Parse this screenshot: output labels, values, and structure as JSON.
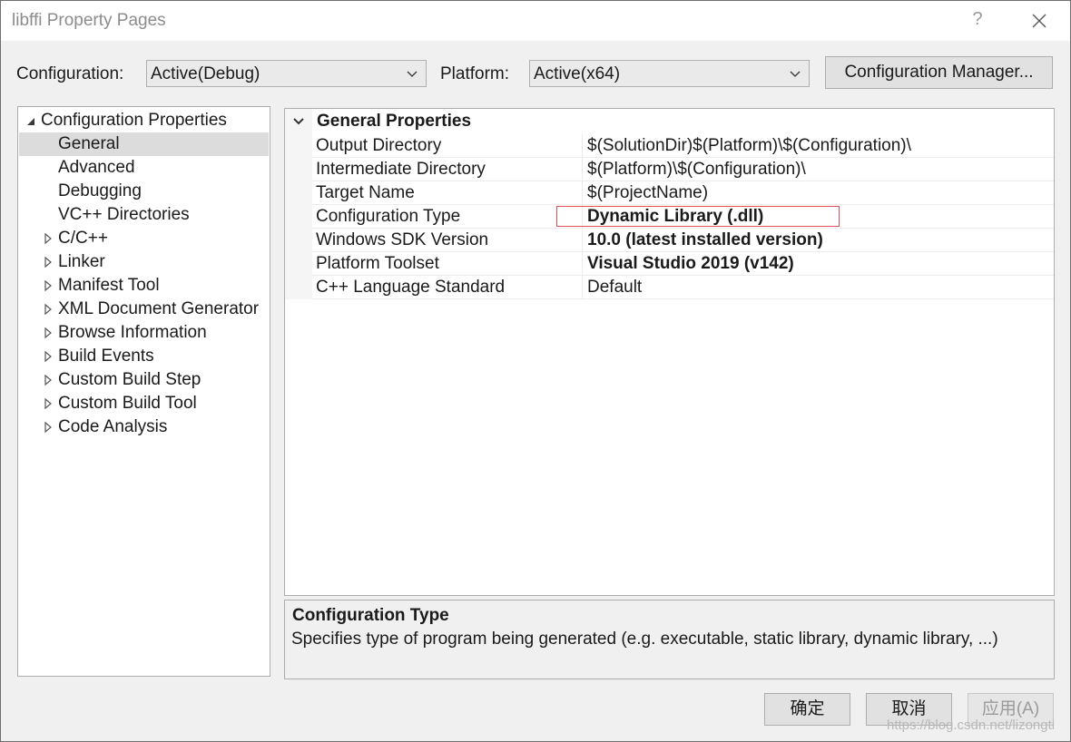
{
  "window": {
    "title": "libffi Property Pages",
    "help_glyph": "?"
  },
  "header": {
    "configuration_label": "Configuration:",
    "configuration_value": "Active(Debug)",
    "platform_label": "Platform:",
    "platform_value": "Active(x64)",
    "config_manager_label": "Configuration Manager..."
  },
  "tree": {
    "root_label": "Configuration Properties",
    "items": [
      {
        "label": "General",
        "expandable": false,
        "selected": true
      },
      {
        "label": "Advanced",
        "expandable": false
      },
      {
        "label": "Debugging",
        "expandable": false
      },
      {
        "label": "VC++ Directories",
        "expandable": false
      },
      {
        "label": "C/C++",
        "expandable": true
      },
      {
        "label": "Linker",
        "expandable": true
      },
      {
        "label": "Manifest Tool",
        "expandable": true
      },
      {
        "label": "XML Document Generator",
        "expandable": true
      },
      {
        "label": "Browse Information",
        "expandable": true
      },
      {
        "label": "Build Events",
        "expandable": true
      },
      {
        "label": "Custom Build Step",
        "expandable": true
      },
      {
        "label": "Custom Build Tool",
        "expandable": true
      },
      {
        "label": "Code Analysis",
        "expandable": true
      }
    ]
  },
  "grid": {
    "category": "General Properties",
    "rows": [
      {
        "name": "Output Directory",
        "value": "$(SolutionDir)$(Platform)\\$(Configuration)\\",
        "bold": false
      },
      {
        "name": "Intermediate Directory",
        "value": "$(Platform)\\$(Configuration)\\",
        "bold": false
      },
      {
        "name": "Target Name",
        "value": "$(ProjectName)",
        "bold": false
      },
      {
        "name": "Configuration Type",
        "value": "Dynamic Library (.dll)",
        "bold": true
      },
      {
        "name": "Windows SDK Version",
        "value": "10.0 (latest installed version)",
        "bold": true
      },
      {
        "name": "Platform Toolset",
        "value": "Visual Studio 2019 (v142)",
        "bold": true
      },
      {
        "name": "C++ Language Standard",
        "value": "Default",
        "bold": false
      }
    ]
  },
  "description": {
    "title": "Configuration Type",
    "text": "Specifies type of program being generated (e.g. executable, static library, dynamic library, ...)"
  },
  "buttons": {
    "ok": "确定",
    "cancel": "取消",
    "apply": "应用(A)"
  },
  "watermark": "https://blog.csdn.net/lizongti",
  "colors": {
    "highlight_border": "#e0505a",
    "selection_bg": "#dcdcdc",
    "dialog_bg": "#f0f0f0"
  }
}
